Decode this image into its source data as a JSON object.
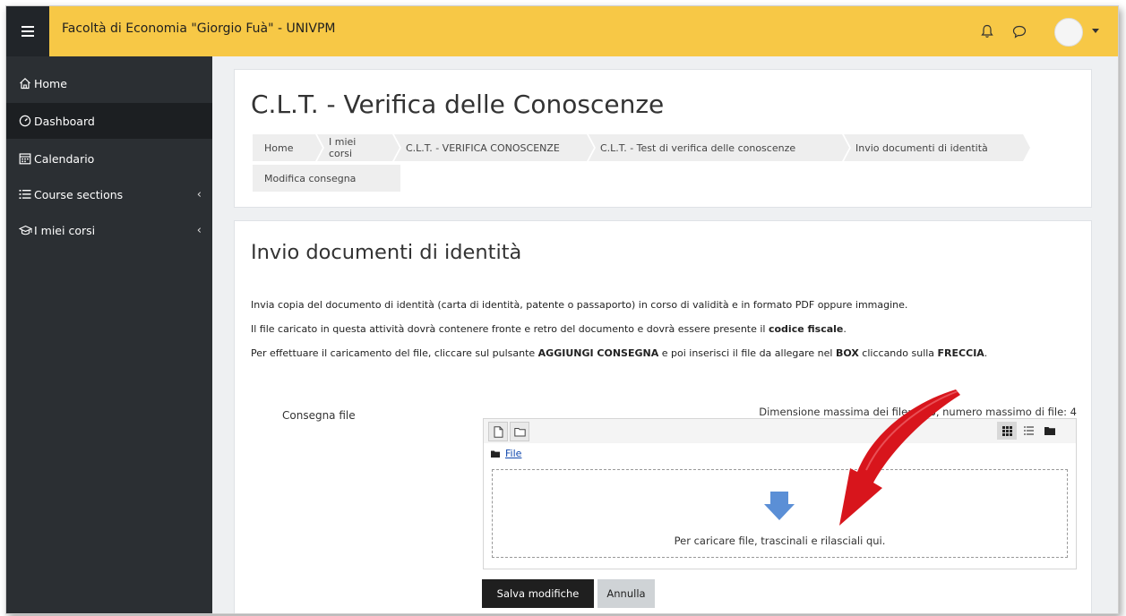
{
  "header": {
    "menu_icon": "hamburger-icon",
    "site_name": "Facoltà di Economia \"Giorgio Fuà\" - UNIVPM",
    "icons": [
      "bell-icon",
      "chat-icon",
      "avatar",
      "chevron-down-icon"
    ]
  },
  "sidebar": {
    "items": [
      {
        "label": "Home",
        "icon": "home-icon"
      },
      {
        "label": "Dashboard",
        "icon": "gauge-icon"
      },
      {
        "label": "Calendario",
        "icon": "calendar-icon"
      },
      {
        "label": "Course sections",
        "icon": "list-icon"
      },
      {
        "label": "I miei corsi",
        "icon": "graduation-cap-icon"
      }
    ]
  },
  "course_header": {
    "title": "C.L.T. - Verifica delle Conoscenze",
    "breadcrumb": [
      "Home",
      "I miei corsi",
      "C.L.T. - VERIFICA CONOSCENZE",
      "C.L.T. - Test di verifica delle conoscenze",
      "Invio documenti di identità",
      "Modifica consegna"
    ]
  },
  "assignment": {
    "title": "Invio documenti di identità",
    "para1": "Invia copia del documento di identità (carta di identità, patente o passaporto) in corso di validità e in formato PDF oppure immagine.",
    "para2_pre": "Il file caricato in questa attività dovrà contenere fronte e retro del documento e dovrà essere presente il ",
    "para2_bold": "codice fiscale",
    "para2_post": ".",
    "para3_a": "Per effettuare il caricamento del file, cliccare sul pulsante ",
    "para3_b": "AGGIUNGI CONSEGNA",
    "para3_c": " e poi inserisci il file da allegare nel ",
    "para3_d": "BOX",
    "para3_e": " cliccando sulla ",
    "para3_f": "FRECCIA",
    "para3_g": ".",
    "field_label": "Consegna file",
    "max_info": "Dimensione massima dei file: 1GB, numero massimo di file: 4",
    "file_path": "File",
    "dropzone_text": "Per caricare file, trascinali e rilasciali qui.",
    "save_label": "Salva modifiche",
    "cancel_label": "Annulla"
  },
  "colors": {
    "topbar": "#f7c846",
    "sidebar": "#2b2f33",
    "annotation_arrow": "#d8151c",
    "upload_arrow": "#5b8fd6"
  }
}
